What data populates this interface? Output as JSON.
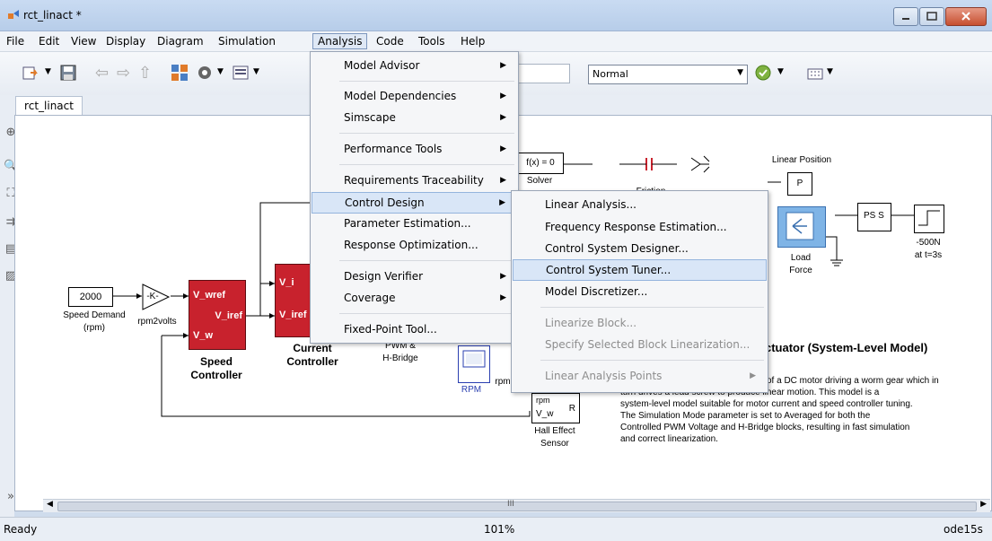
{
  "window": {
    "title": "rct_linact *"
  },
  "menubar": [
    "File",
    "Edit",
    "View",
    "Display",
    "Diagram",
    "Simulation",
    "Analysis",
    "Code",
    "Tools",
    "Help"
  ],
  "toolbar": {
    "mode_value": "Normal"
  },
  "tab": "rct_linact",
  "analysis_menu": {
    "items": [
      "Model Advisor",
      "Model Dependencies",
      "Simscape",
      "Performance Tools",
      "Requirements Traceability",
      "Control Design",
      "Parameter Estimation...",
      "Response Optimization...",
      "Design Verifier",
      "Coverage",
      "Fixed-Point Tool..."
    ]
  },
  "control_design_menu": {
    "items": [
      "Linear Analysis...",
      "Frequency Response Estimation...",
      "Control System Designer...",
      "Control System Tuner...",
      "Model Discretizer...",
      "Linearize Block...",
      "Specify Selected Block Linearization...",
      "Linear Analysis Points"
    ]
  },
  "diagram": {
    "speed_demand_value": "2000",
    "speed_demand_label1": "Speed Demand",
    "speed_demand_label2": "(rpm)",
    "gain_text": "-K-",
    "gain_label": "rpm2volts",
    "speed_ctrl_in1": "V_wref",
    "speed_ctrl_out": "V_iref",
    "speed_ctrl_in2": "V_w",
    "speed_ctrl_label1": "Speed",
    "speed_ctrl_label2": "Controller",
    "current_ctrl_in1": "V_i",
    "current_ctrl_in2": "V_iref",
    "current_ctrl_label1": "Current",
    "current_ctrl_label2": "Controller",
    "pwm_label1": "PWM &",
    "pwm_label2": "H-Bridge",
    "scope_label": "RPM",
    "scope_rpm": "rpm",
    "solver_text": "f(x) = 0",
    "solver_label": "Solver",
    "friction_label": "Friction",
    "linear_position_label": "Linear Position",
    "sensor_p": "P",
    "load_label1": "Load",
    "load_label2": "Force",
    "ps_s": "PS S",
    "step_label1": "-500N",
    "step_label2": "at t=3s",
    "hall_rpm": "rpm",
    "hall_vw": "V_w",
    "hall_r": "R",
    "hall_label1": "Hall Effect",
    "hall_label2": "Sensor",
    "desc_title": "ctuator (System-Level Model)",
    "desc_line1": "of a DC motor driving a worm gear which in",
    "desc_line2": "turn drives a lead screw to produce linear motion. This model is a",
    "desc_line3": "system-level model suitable for motor current and speed controller tuning.",
    "desc_line4": "The Simulation Mode parameter is set to Averaged for both the",
    "desc_line5": "Controlled PWM Voltage and H-Bridge blocks, resulting in fast simulation",
    "desc_line6": "and correct linearization."
  },
  "scroll_mark": "III",
  "status": {
    "left": "Ready",
    "zoom": "101%",
    "solver": "ode15s"
  }
}
